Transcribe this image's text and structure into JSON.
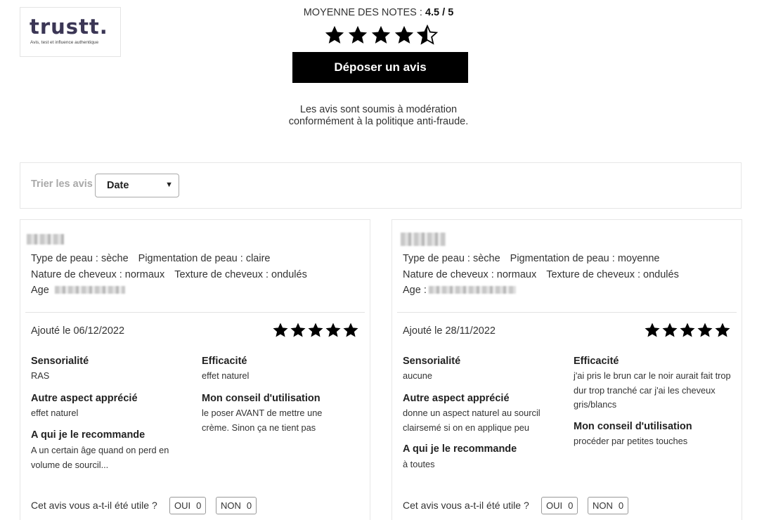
{
  "logo": {
    "word": "trustt.",
    "tagline": "Avis, test et influence authentique"
  },
  "summary": {
    "label": "MOYENNE DES NOTES :",
    "score": "4.5 / 5",
    "rating": 4.5,
    "cta": "Déposer un avis",
    "moderation_line1": "Les avis sont soumis à modération",
    "moderation_line2": "conformément à la politique anti-fraude."
  },
  "sort": {
    "label": "Trier les avis",
    "selected": "Date"
  },
  "colors": {
    "button_bg": "#000000",
    "star": "#000000",
    "sort_label": "#a9a9a9"
  },
  "reviews": [
    {
      "skin_type": "Type de peau : sèche",
      "skin_pigmentation": "Pigmentation de peau : claire",
      "hair_nature": "Nature de cheveux : normaux",
      "hair_texture": "Texture de cheveux : ondulés",
      "age_label": "Age",
      "date": "Ajouté le 06/12/2022",
      "rating": 5,
      "sensoriality_title": "Sensorialité",
      "sensoriality": "RAS",
      "efficacy_title": "Efficacité",
      "efficacy": "effet naturel",
      "other_title": "Autre aspect apprécié",
      "other": "effet naturel",
      "advice_title": "Mon conseil d'utilisation",
      "advice": "le poser AVANT de mettre une crème. Sinon ça ne tient pas",
      "recommend_title": "A qui je le recommande",
      "recommend": "A un certain âge quand on perd en volume de sourcil...",
      "helpful_q": "Cet avis vous a-t-il été utile ?",
      "yes_label": "OUI",
      "yes_count": "0",
      "no_label": "NON",
      "no_count": "0"
    },
    {
      "skin_type": "Type de peau : sèche",
      "skin_pigmentation": "Pigmentation de peau : moyenne",
      "hair_nature": "Nature de cheveux : normaux",
      "hair_texture": "Texture de cheveux : ondulés",
      "age_label": "Age :",
      "date": "Ajouté le 28/11/2022",
      "rating": 5,
      "sensoriality_title": "Sensorialité",
      "sensoriality": "aucune",
      "efficacy_title": "Efficacité",
      "efficacy": "j'ai pris le brun car le noir aurait fait trop dur trop tranché car j'ai les cheveux gris/blancs",
      "other_title": "Autre aspect apprécié",
      "other": "donne un aspect naturel au sourcil clairsemé si on en applique peu",
      "advice_title": "Mon conseil d'utilisation",
      "advice": "procéder par petites touches",
      "recommend_title": "A qui je le recommande",
      "recommend": "à toutes",
      "helpful_q": "Cet avis vous a-t-il été utile ?",
      "yes_label": "OUI",
      "yes_count": "0",
      "no_label": "NON",
      "no_count": "0"
    }
  ]
}
